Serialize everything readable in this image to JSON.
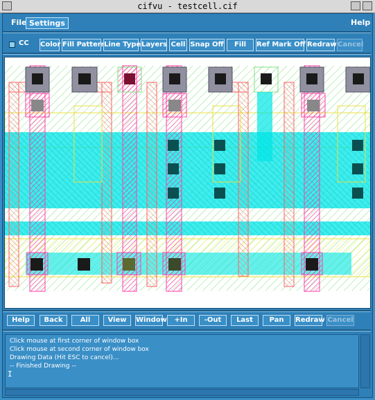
{
  "window": {
    "title": "cifvu - testcell.cif"
  },
  "menubar": {
    "file": "File",
    "settings": "Settings",
    "help": "Help"
  },
  "toolbar": {
    "cc_label": "CC",
    "color": "Color",
    "fill_pattern": "Fill Pattern",
    "line_type": "Line Type",
    "layers": "Layers",
    "cell": "Cell",
    "snap_off": "Snap Off",
    "fill": "Fill",
    "ref_mark_off": "Ref Mark Off",
    "redraw": "Redraw",
    "cancel": "Cancel"
  },
  "navbar": {
    "help": "Help",
    "back": "Back",
    "all": "All",
    "view": "View",
    "window": "Window",
    "zoom_in": "+In",
    "zoom_out": "-Out",
    "last": "Last",
    "pan": "Pan",
    "redraw": "Redraw",
    "cancel": "Cancel"
  },
  "console": {
    "lines": [
      "Click mouse at first corner of window box",
      "Click mouse at second corner of window box",
      "Drawing Data (Hit ESC to cancel)...",
      "-- Finished Drawing --"
    ],
    "caret": "I"
  },
  "colors": {
    "background": "#3a8fc7",
    "diffusion": "#00e0e0",
    "poly": "#ff3fa8",
    "metal": "#ff9a9a",
    "well": "#90f090",
    "implant": "#ffff70",
    "contact": "#101010"
  }
}
